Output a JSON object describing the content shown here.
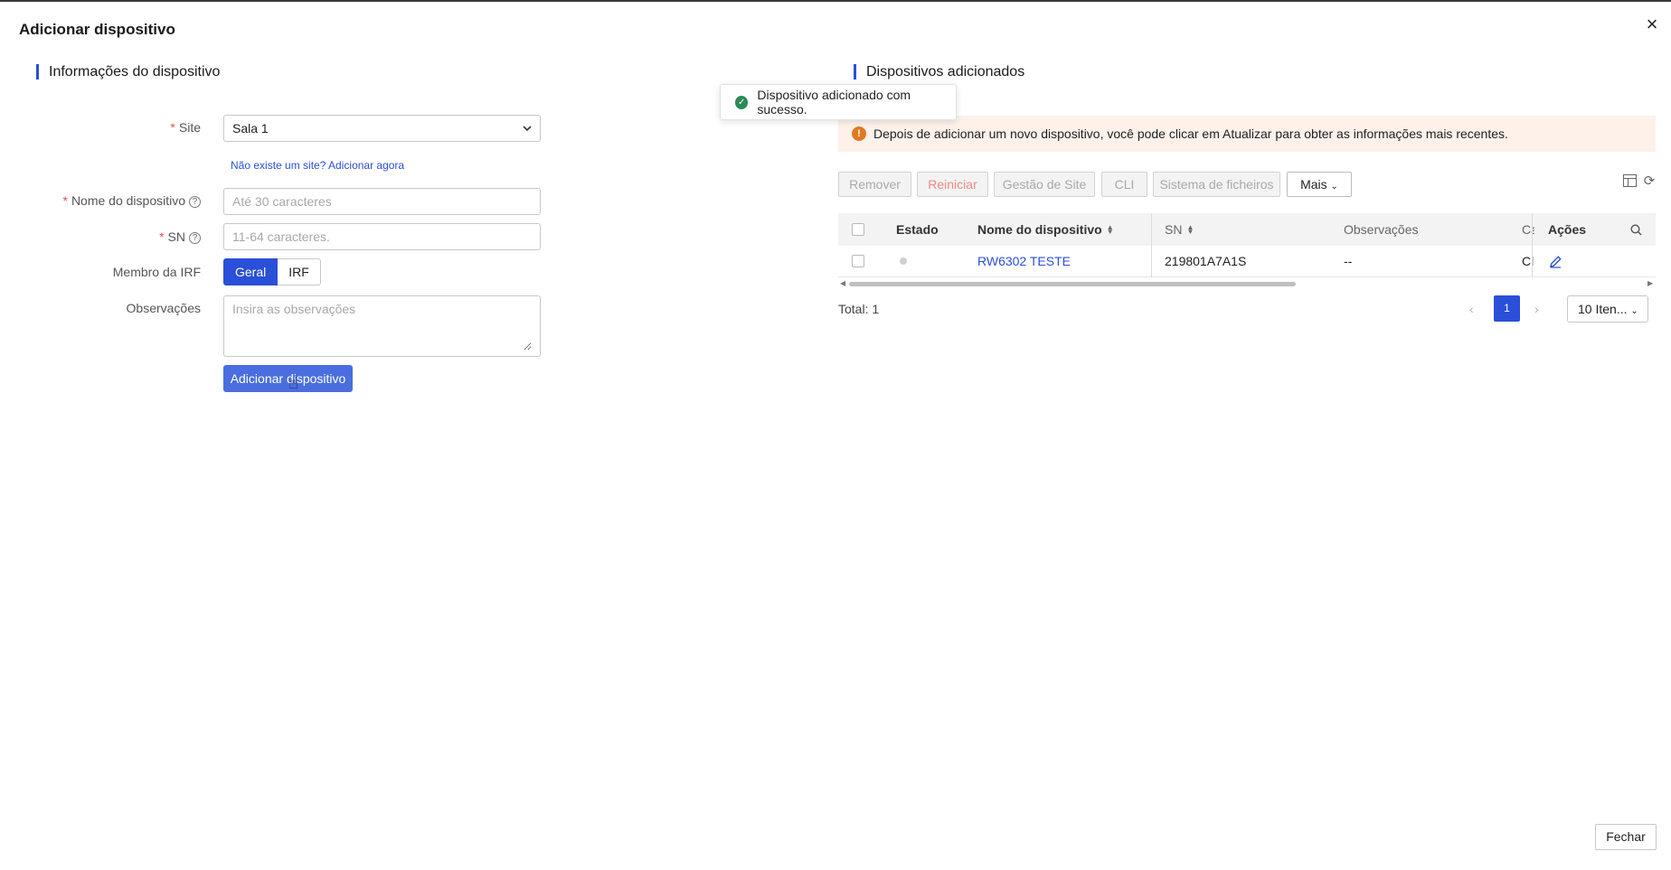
{
  "dialog": {
    "title": "Adicionar dispositivo",
    "close_icon": "×",
    "close_button": "Fechar"
  },
  "left": {
    "section_title": "Informações do dispositivo",
    "site": {
      "label": "Site",
      "value": "Sala 1"
    },
    "no_site_link": "Não existe um site? Adicionar agora",
    "device_name": {
      "label": "Nome do dispositivo",
      "placeholder": "Até 30 caracteres"
    },
    "sn": {
      "label": "SN",
      "placeholder": "11-64 caracteres."
    },
    "irf": {
      "label": "Membro da IRF",
      "options": [
        "Geral",
        "IRF"
      ],
      "selected": "Geral"
    },
    "notes": {
      "label": "Observações",
      "placeholder": "Insira as observações"
    },
    "add_button": "Adicionar dispositivo"
  },
  "toast": {
    "message": "Dispositivo adicionado com sucesso."
  },
  "right": {
    "section_title": "Dispositivos adicionados",
    "alert": "Depois de adicionar um novo dispositivo, você pode clicar em Atualizar para obter as informações mais recentes.",
    "toolbar": {
      "remove": "Remover",
      "restart": "Reiniciar",
      "site_mgmt": "Gestão de Site",
      "cli": "CLI",
      "filesystem": "Sistema de ficheiros",
      "more": "Mais"
    },
    "table": {
      "headers": {
        "status": "Estado",
        "name": "Nome do dispositivo",
        "sn": "SN",
        "notes": "Observações",
        "ca": "Ca",
        "actions": "Ações"
      },
      "rows": [
        {
          "name": "RW6302 TESTE",
          "sn": "219801A7A1S",
          "notes": "--",
          "ca": "Cl"
        }
      ]
    },
    "pagination": {
      "total": "Total: 1",
      "current": "1",
      "page_size": "10 Iten..."
    }
  },
  "colors": {
    "accent": "#2a4fd9",
    "danger": "#e34d59",
    "success": "#2b8a57",
    "warning": "#e07a1f"
  }
}
